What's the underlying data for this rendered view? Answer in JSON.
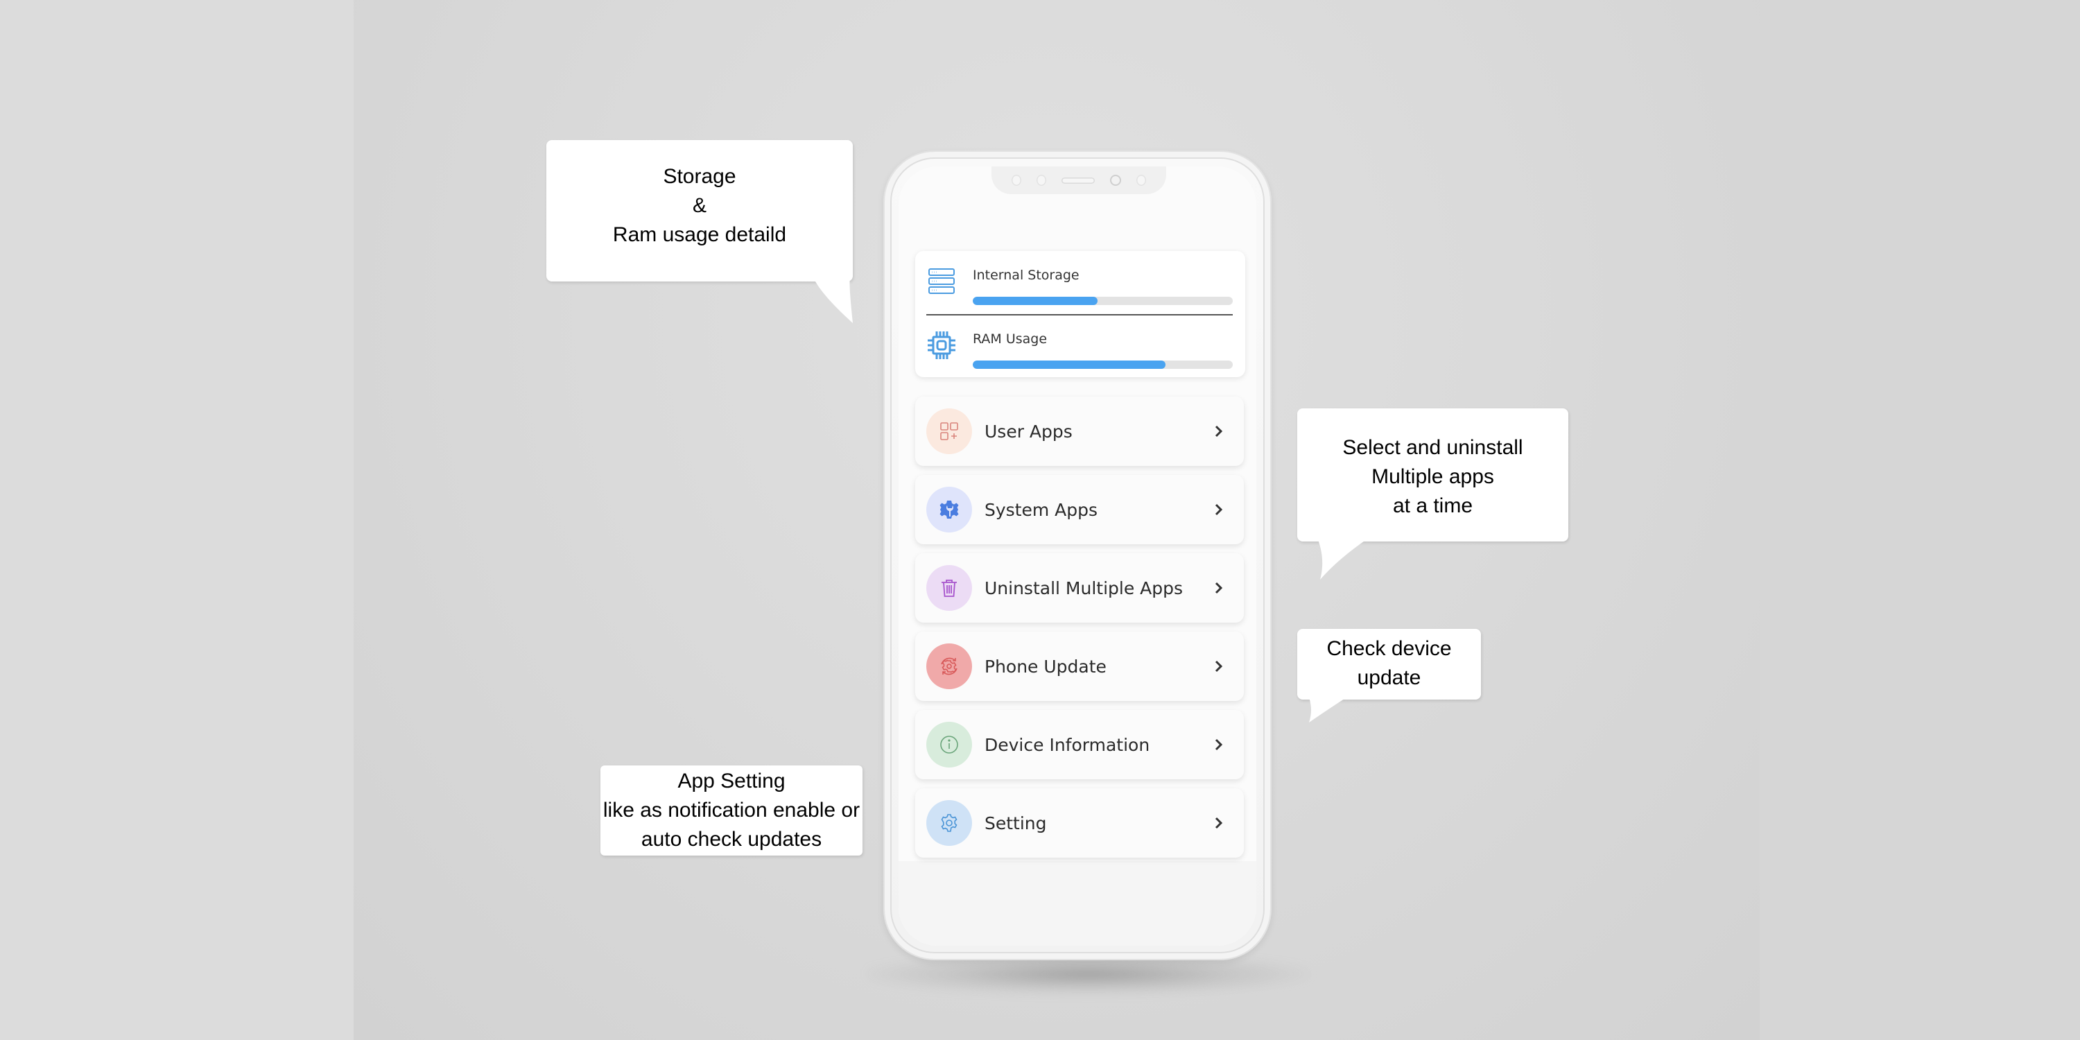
{
  "callouts": {
    "storage": {
      "lines": [
        "Storage",
        "&",
        "Ram usage detaild"
      ]
    },
    "uninstall": {
      "lines": [
        "Select and uninstall",
        "Multiple apps",
        "at a time"
      ]
    },
    "update": {
      "lines": [
        "Check device",
        "update"
      ]
    },
    "setting": {
      "lines": [
        "App Setting",
        "like as notification enable or",
        "auto check updates"
      ]
    }
  },
  "usage": {
    "storage": {
      "label": "Internal Storage",
      "icon": "server-storage-icon",
      "percent": 48,
      "color": "#4aa3f0"
    },
    "ram": {
      "label": "RAM Usage",
      "icon": "cpu-chip-icon",
      "percent": 74,
      "color": "#4aa3f0"
    }
  },
  "menu": {
    "items": [
      {
        "label": "User Apps",
        "icon": "apps-grid-plus-icon",
        "icon_bg": "#fbe9df",
        "icon_color": "#d9847c"
      },
      {
        "label": "System Apps",
        "icon": "gear-wrench-icon",
        "icon_bg": "#dfe4fb",
        "icon_color": "#4a7de0"
      },
      {
        "label": "Uninstall Multiple Apps",
        "icon": "trash-icon",
        "icon_bg": "#ecdcf5",
        "icon_color": "#a652cc"
      },
      {
        "label": "Phone Update",
        "icon": "gear-refresh-icon",
        "icon_bg": "#f0a9a9",
        "icon_color": "#d85a5a"
      },
      {
        "label": "Device Information",
        "icon": "info-circle-icon",
        "icon_bg": "#d8ecdc",
        "icon_color": "#6aa57a"
      },
      {
        "label": "Setting",
        "icon": "gear-icon",
        "icon_bg": "#cfe2f6",
        "icon_color": "#4a94d6"
      }
    ]
  }
}
